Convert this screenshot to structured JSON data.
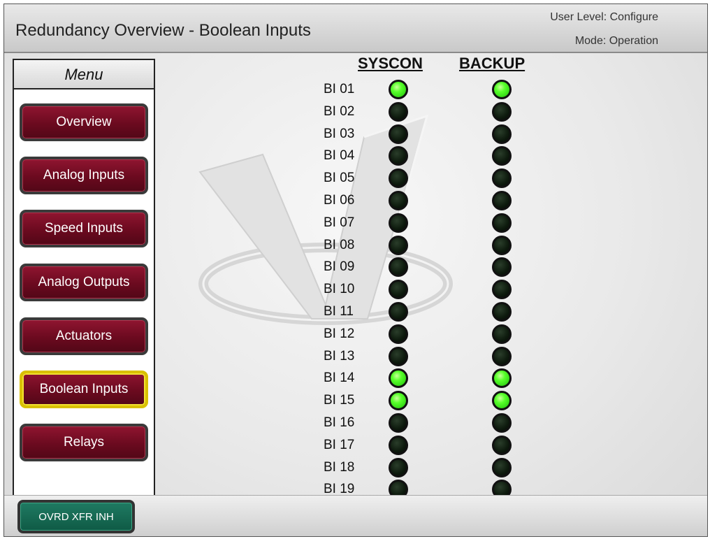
{
  "header": {
    "title": "Redundancy Overview - Boolean Inputs",
    "user_level": "User Level: Configure",
    "mode": "Mode: Operation"
  },
  "menu": {
    "title": "Menu",
    "items": [
      {
        "label": "Overview",
        "active": false
      },
      {
        "label": "Analog Inputs",
        "active": false
      },
      {
        "label": "Speed Inputs",
        "active": false
      },
      {
        "label": "Analog Outputs",
        "active": false
      },
      {
        "label": "Actuators",
        "active": false
      },
      {
        "label": "Boolean Inputs",
        "active": true
      },
      {
        "label": "Relays",
        "active": false
      }
    ]
  },
  "columns": {
    "syscon": "SYSCON",
    "backup": "BACKUP"
  },
  "boolean_inputs": [
    {
      "label": "BI 01",
      "syscon": true,
      "backup": true
    },
    {
      "label": "BI 02",
      "syscon": false,
      "backup": false
    },
    {
      "label": "BI 03",
      "syscon": false,
      "backup": false
    },
    {
      "label": "BI 04",
      "syscon": false,
      "backup": false
    },
    {
      "label": "BI 05",
      "syscon": false,
      "backup": false
    },
    {
      "label": "BI 06",
      "syscon": false,
      "backup": false
    },
    {
      "label": "BI 07",
      "syscon": false,
      "backup": false
    },
    {
      "label": "BI 08",
      "syscon": false,
      "backup": false
    },
    {
      "label": "BI 09",
      "syscon": false,
      "backup": false
    },
    {
      "label": "BI 10",
      "syscon": false,
      "backup": false
    },
    {
      "label": "BI 11",
      "syscon": false,
      "backup": false
    },
    {
      "label": "BI 12",
      "syscon": false,
      "backup": false
    },
    {
      "label": "BI 13",
      "syscon": false,
      "backup": false
    },
    {
      "label": "BI 14",
      "syscon": true,
      "backup": true
    },
    {
      "label": "BI 15",
      "syscon": true,
      "backup": true
    },
    {
      "label": "BI 16",
      "syscon": false,
      "backup": false
    },
    {
      "label": "BI 17",
      "syscon": false,
      "backup": false
    },
    {
      "label": "BI 18",
      "syscon": false,
      "backup": false
    },
    {
      "label": "BI 19",
      "syscon": false,
      "backup": false
    }
  ],
  "footer": {
    "ovrd_label": "OVRD XFR INH"
  },
  "colors": {
    "led_on": "#57ff2a",
    "led_off": "#0d1a0d",
    "menu_button": "#6b0a1f",
    "menu_active_border": "#d9c100",
    "ovrd_button": "#0f5a45"
  }
}
